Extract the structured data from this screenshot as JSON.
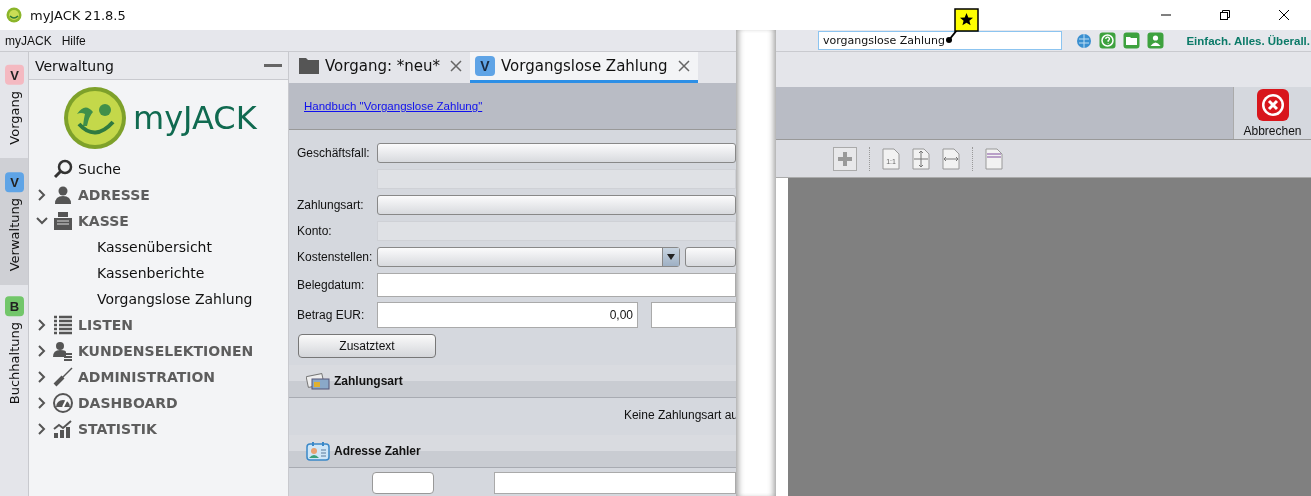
{
  "window": {
    "title": "myJACK 21.8.5"
  },
  "menu": [
    "myJACK",
    "Hilfe"
  ],
  "search": {
    "value": "vorgangslose Zahlung"
  },
  "slogan": "Einfach. Alles. Überall.",
  "side_tabs": [
    {
      "label": "Vorgang",
      "badge": "V",
      "color": "#f4b9c1",
      "selected": false
    },
    {
      "label": "Verwaltung",
      "badge": "V",
      "color": "#5fa4e6",
      "selected": true
    },
    {
      "label": "Buchhaltung",
      "badge": "B",
      "color": "#72c66a",
      "selected": false
    }
  ],
  "sidebar": {
    "title": "Verwaltung",
    "logo_text": "myJACK",
    "items": [
      {
        "label": "Suche",
        "kind": "plain"
      },
      {
        "label": "ADRESSE",
        "kind": "group",
        "expanded": false
      },
      {
        "label": "KASSE",
        "kind": "group",
        "expanded": true,
        "children": [
          {
            "label": "Kassenübersicht"
          },
          {
            "label": "Kassenberichte"
          },
          {
            "label": "Vorgangslose Zahlung"
          }
        ]
      },
      {
        "label": "LISTEN",
        "kind": "group",
        "expanded": false
      },
      {
        "label": "KUNDENSELEKTIONEN",
        "kind": "group",
        "expanded": false
      },
      {
        "label": "ADMINISTRATION",
        "kind": "group",
        "expanded": false
      },
      {
        "label": "DASHBOARD",
        "kind": "group",
        "expanded": false
      },
      {
        "label": "STATISTIK",
        "kind": "group",
        "expanded": false
      }
    ]
  },
  "tabs": [
    {
      "label": "Vorgang: *neu*",
      "kind": "folder",
      "selected": false
    },
    {
      "label": "Vorgangslose Zahlung",
      "kind": "badge",
      "badge": "V",
      "selected": true
    }
  ],
  "info_link": "Handbuch \"Vorgangslose Zahlung\"",
  "cancel_button": "Abbrechen",
  "viewer_toolbar": {
    "actual_size_label": "1:1"
  },
  "form": {
    "rows": [
      {
        "label": "Geschäftsfall:",
        "kind": "combo"
      },
      {
        "kind": "readonly"
      },
      {
        "label": "Zahlungsart:",
        "kind": "combo"
      },
      {
        "label": "Konto:",
        "kind": "readonly"
      },
      {
        "label": "Kostenstellen:",
        "kind": "combo_split"
      },
      {
        "label": "Belegdatum:",
        "kind": "text"
      },
      {
        "label": "Betrag EUR:",
        "kind": "amount",
        "value": "0,00"
      }
    ],
    "button": "Zusatztext",
    "sections": [
      {
        "title": "Zahlungsart",
        "kind": "payment",
        "message": "Keine Zahlungsart au"
      },
      {
        "title": "Adresse Zahler",
        "kind": "address"
      }
    ]
  }
}
